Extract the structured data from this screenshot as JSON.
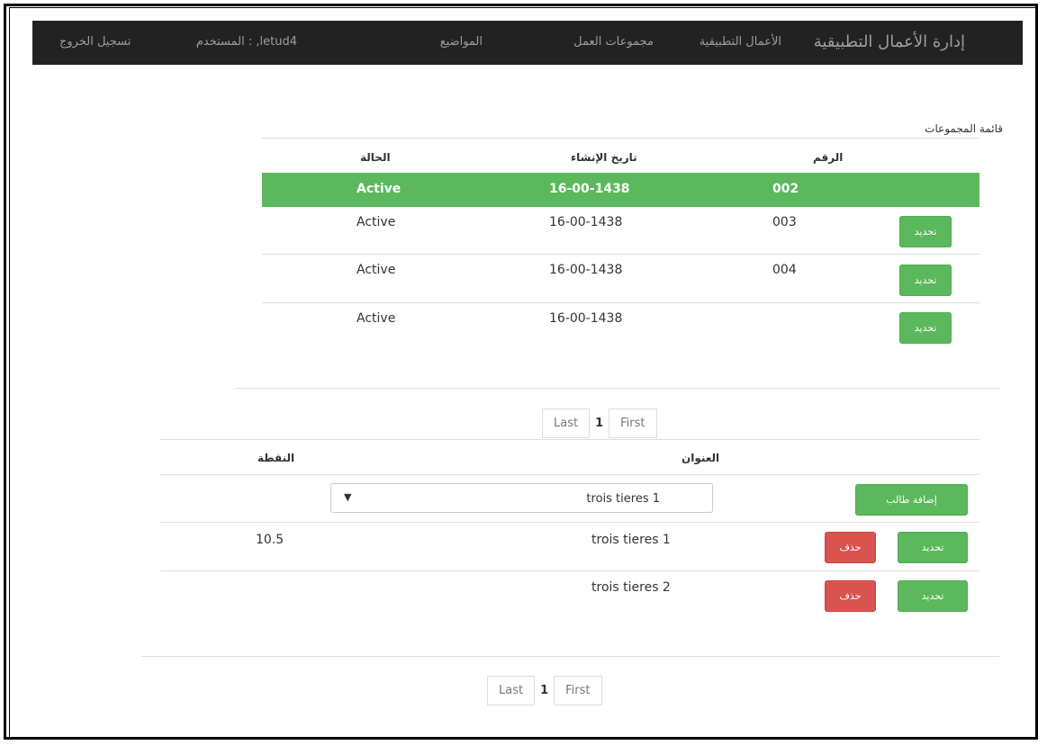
{
  "nav": {
    "brand": "إدارة الأعمال التطبيقية",
    "items": [
      "الأعمال التطبيقية",
      "مجموعات العمل",
      "المواضيع"
    ],
    "user_label": "المستخدم : ,letud4",
    "logout": "تسجيل الخروج"
  },
  "groups": {
    "caption": "قائمة المجموعات",
    "headers": {
      "number": "الرقم",
      "created": "تاريخ الإنشاء",
      "status": "الحالة"
    },
    "rows": [
      {
        "number": "002",
        "date": "16-00-1438",
        "status": "Active"
      },
      {
        "number": "003",
        "date": "16-00-1438",
        "status": "Active",
        "action": "تحديد"
      },
      {
        "number": "004",
        "date": "16-00-1438",
        "status": "Active",
        "action": "تحديد"
      },
      {
        "number": "",
        "date": "16-00-1438",
        "status": "Active",
        "action": "تحديد"
      }
    ]
  },
  "pager1": {
    "first": "First",
    "page": "1",
    "last": "Last"
  },
  "topics": {
    "headers": {
      "title": "العنوان",
      "score": "النقطة"
    },
    "add_button": "إضافة طالب",
    "select_value": "trois tieres 1",
    "select_arrow": "▼",
    "rows": [
      {
        "title": "trois tieres 1",
        "score": "10.5",
        "select": "تحديد",
        "delete": "حذف"
      },
      {
        "title": "trois tieres 2",
        "score": "",
        "select": "تحديد",
        "delete": "حذف"
      }
    ]
  },
  "pager2": {
    "first": "First",
    "page": "1",
    "last": "Last"
  },
  "colors": {
    "navbar": "#222222",
    "success": "#5cb85c",
    "danger": "#d9534f"
  }
}
